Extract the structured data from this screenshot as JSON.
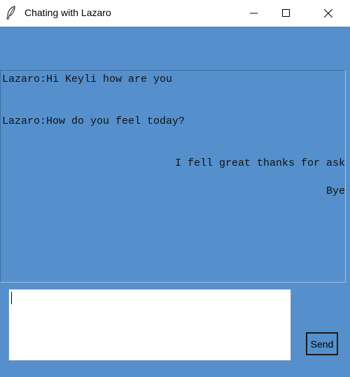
{
  "window": {
    "title": "Chating with Lazaro",
    "icon": "feather-icon",
    "controls": [
      "minimize-icon",
      "maximize-icon",
      "close-icon"
    ]
  },
  "chat": {
    "messages": [
      {
        "text": "Lazaro:Hi Keyli how are you",
        "align": "left"
      },
      {
        "text": "Lazaro:How do you feel today?",
        "align": "left"
      },
      {
        "text": "I fell great thanks for ask",
        "align": "right"
      },
      {
        "text": "Bye",
        "align": "right"
      }
    ]
  },
  "composer": {
    "value": "",
    "send_label": "Send"
  },
  "colors": {
    "background": "#5590cc",
    "input": "#ffffff"
  }
}
